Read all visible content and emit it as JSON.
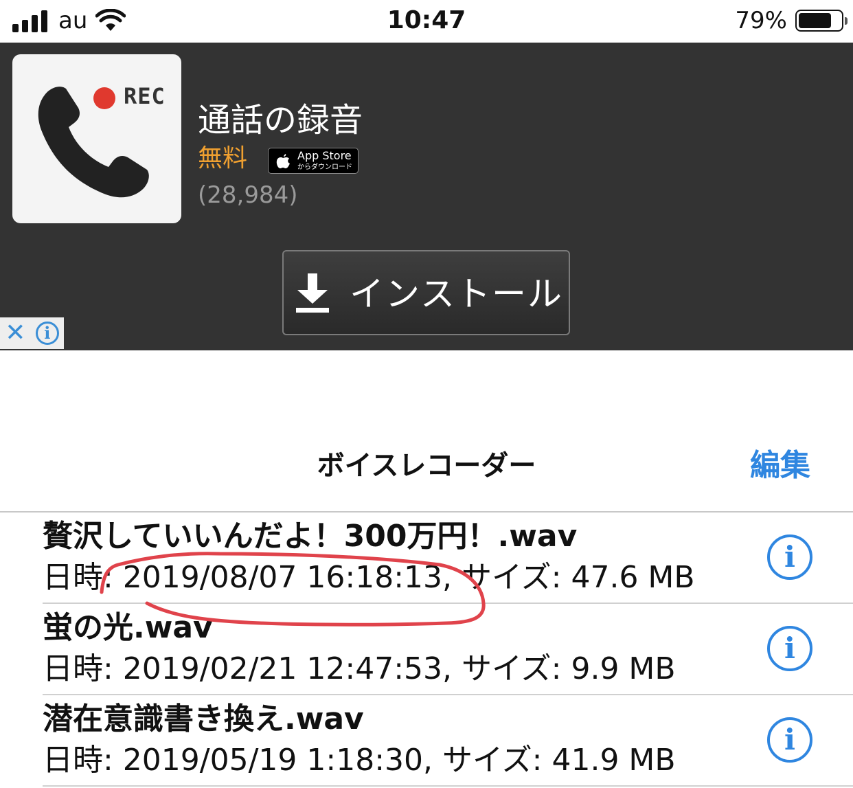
{
  "status_bar": {
    "carrier": "au",
    "time": "10:47",
    "battery_percent": "79%",
    "battery_level": 0.79,
    "icons": [
      "signal-icon",
      "wifi-icon",
      "battery-icon"
    ]
  },
  "ad": {
    "app_name": "通話の録音",
    "price": "無料",
    "reviews": "(28,984)",
    "rec_label": "REC",
    "badge_line1": "App Store",
    "badge_line2": "からダウンロード",
    "install_label": "インストール",
    "colors": {
      "background": "#333333",
      "price": "#f0a030",
      "rec_dot": "#e0392e"
    }
  },
  "nav": {
    "title": "ボイスレコーダー",
    "edit_label": "編集",
    "accent": "#2f86e0"
  },
  "recordings": [
    {
      "title": "贅沢していいんだよ！300万円！.wav",
      "meta": "日時: 2019/08/07 16:18:13, サイズ: 47.6 MB"
    },
    {
      "title": "蛍の光.wav",
      "meta": "日時: 2019/02/21 12:47:53, サイズ: 9.9 MB"
    },
    {
      "title": "潜在意識書き換え.wav",
      "meta": "日時: 2019/05/19 1:18:30, サイズ: 41.9 MB"
    }
  ],
  "annotation": {
    "color": "#e0434b"
  }
}
